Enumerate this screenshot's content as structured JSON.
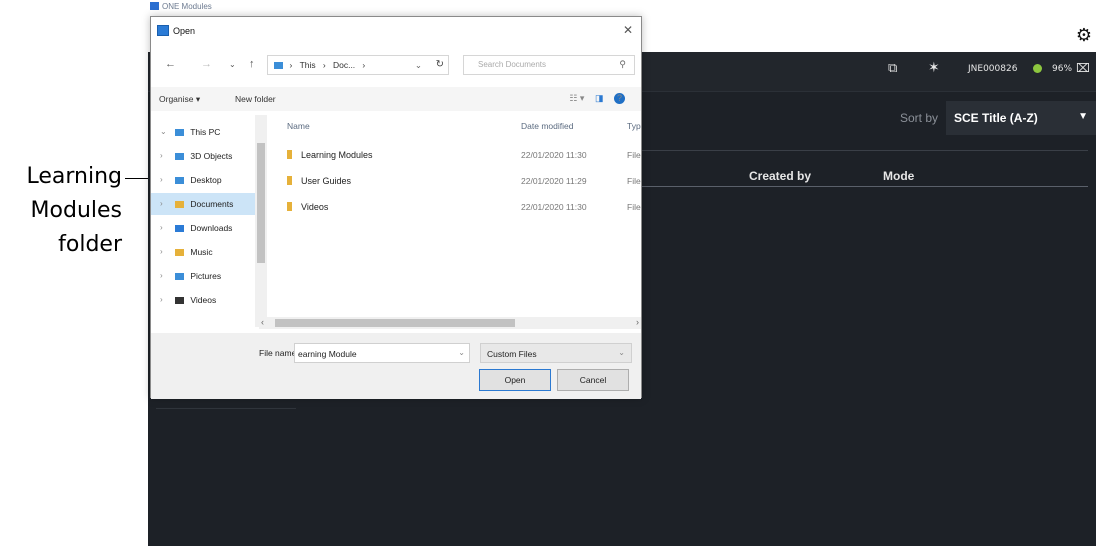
{
  "callout": {
    "lines": [
      "Learning",
      "Modules",
      "folder"
    ]
  },
  "app": {
    "title": "ONE Modules",
    "settings_icon": "gear-icon",
    "toolbar": {
      "device_id": "JNE000826",
      "status_color": "#8dc63f",
      "battery": "96%"
    },
    "sort": {
      "label": "Sort by",
      "value": "SCE Title (A-Z)"
    },
    "table": {
      "columns": [
        "Created by",
        "Mode"
      ]
    }
  },
  "dialog": {
    "title": "Open",
    "nav": {
      "path": [
        "This",
        "Doc..."
      ],
      "search_placeholder": "Search Documents"
    },
    "commands": {
      "organise": "Organise ▾",
      "new_folder": "New folder"
    },
    "nav_pane": [
      {
        "label": "This PC",
        "expanded": true,
        "icon": "computer-icon",
        "color": "#3b8ed8"
      },
      {
        "label": "3D Objects",
        "icon": "cube-folder-icon",
        "color": "#3b8ed8"
      },
      {
        "label": "Desktop",
        "icon": "desktop-folder-icon",
        "color": "#3b8ed8"
      },
      {
        "label": "Documents",
        "icon": "documents-folder-icon",
        "color": "#e6b13a",
        "selected": true
      },
      {
        "label": "Downloads",
        "icon": "downloads-folder-icon",
        "color": "#2b7bd6"
      },
      {
        "label": "Music",
        "icon": "music-folder-icon",
        "color": "#e6b13a"
      },
      {
        "label": "Pictures",
        "icon": "pictures-folder-icon",
        "color": "#3b8ed8"
      },
      {
        "label": "Videos",
        "icon": "videos-folder-icon",
        "color": "#333333"
      }
    ],
    "columns": {
      "name": "Name",
      "date": "Date modified",
      "type": "Typ"
    },
    "files": [
      {
        "name": "Learning Modules",
        "date": "22/01/2020 11:30",
        "type": "File"
      },
      {
        "name": "User Guides",
        "date": "22/01/2020 11:29",
        "type": "File"
      },
      {
        "name": "Videos",
        "date": "22/01/2020 11:30",
        "type": "File"
      }
    ],
    "footer": {
      "file_name_label": "File name:",
      "file_name_value": "earning Module",
      "filter": "Custom Files",
      "open": "Open",
      "cancel": "Cancel"
    }
  }
}
